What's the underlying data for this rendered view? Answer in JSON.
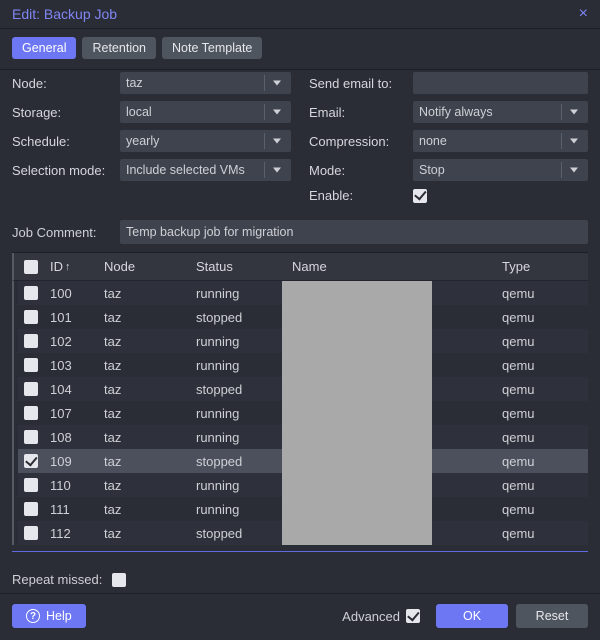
{
  "title": "Edit: Backup Job",
  "tabs": {
    "general": "General",
    "retention": "Retention",
    "note_template": "Note Template",
    "active": "general"
  },
  "left": {
    "node": {
      "label": "Node:",
      "value": "taz"
    },
    "storage": {
      "label": "Storage:",
      "value": "local"
    },
    "schedule": {
      "label": "Schedule:",
      "value": "yearly"
    },
    "selmode": {
      "label": "Selection mode:",
      "value": "Include selected VMs"
    }
  },
  "right": {
    "sendto": {
      "label": "Send email to:",
      "value": ""
    },
    "email": {
      "label": "Email:",
      "value": "Notify always"
    },
    "compress": {
      "label": "Compression:",
      "value": "none"
    },
    "mode": {
      "label": "Mode:",
      "value": "Stop"
    },
    "enable": {
      "label": "Enable:",
      "checked": true
    }
  },
  "comment": {
    "label": "Job Comment:",
    "value": "Temp backup job for migration"
  },
  "grid": {
    "headers": {
      "id": "ID",
      "node": "Node",
      "status": "Status",
      "name": "Name",
      "type": "Type"
    },
    "rows": [
      {
        "id": "100",
        "node": "taz",
        "status": "running",
        "name": "",
        "type": "qemu",
        "checked": false
      },
      {
        "id": "101",
        "node": "taz",
        "status": "stopped",
        "name": "",
        "type": "qemu",
        "checked": false
      },
      {
        "id": "102",
        "node": "taz",
        "status": "running",
        "name": "",
        "type": "qemu",
        "checked": false
      },
      {
        "id": "103",
        "node": "taz",
        "status": "running",
        "name": "",
        "type": "qemu",
        "checked": false
      },
      {
        "id": "104",
        "node": "taz",
        "status": "stopped",
        "name": "",
        "type": "qemu",
        "checked": false
      },
      {
        "id": "107",
        "node": "taz",
        "status": "running",
        "name": "",
        "type": "qemu",
        "checked": false
      },
      {
        "id": "108",
        "node": "taz",
        "status": "running",
        "name": "",
        "type": "qemu",
        "checked": false
      },
      {
        "id": "109",
        "node": "taz",
        "status": "stopped",
        "name": "",
        "type": "qemu",
        "checked": true
      },
      {
        "id": "110",
        "node": "taz",
        "status": "running",
        "name": "",
        "type": "qemu",
        "checked": false
      },
      {
        "id": "111",
        "node": "taz",
        "status": "running",
        "name": "",
        "type": "qemu",
        "checked": false
      },
      {
        "id": "112",
        "node": "taz",
        "status": "stopped",
        "name": "",
        "type": "qemu",
        "checked": false
      }
    ]
  },
  "repeat": {
    "label": "Repeat missed:",
    "checked": false
  },
  "footer": {
    "help": "Help",
    "advanced": "Advanced",
    "advanced_checked": true,
    "ok": "OK",
    "reset": "Reset"
  }
}
